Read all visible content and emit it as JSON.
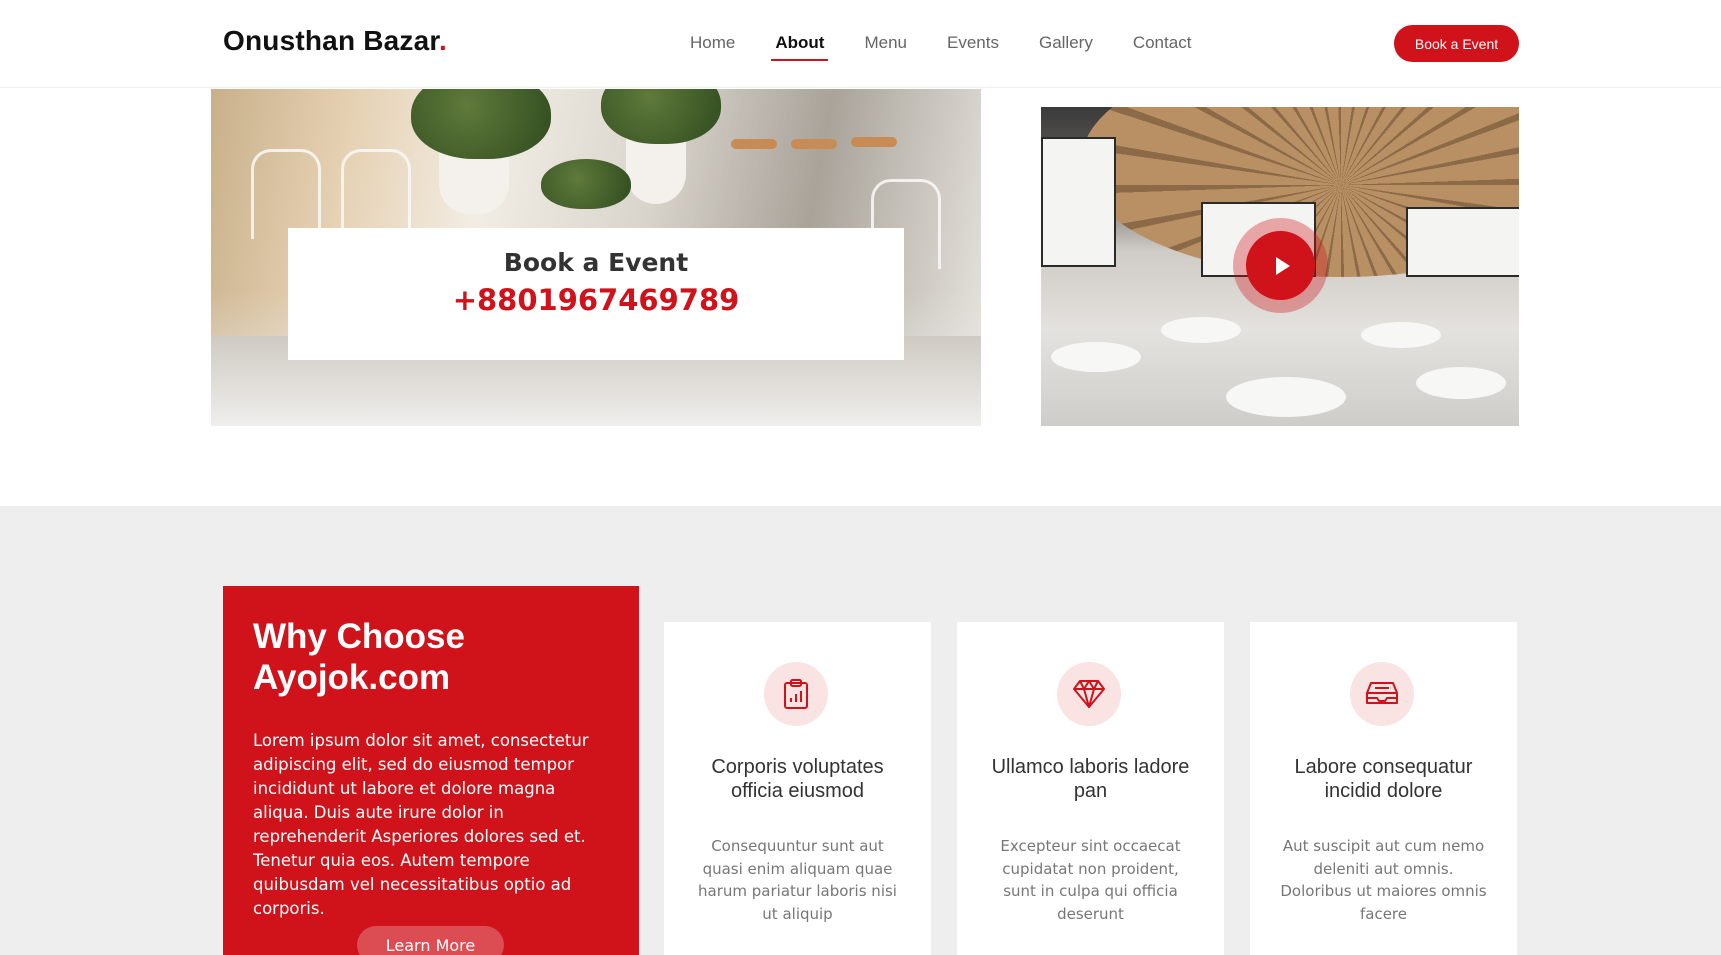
{
  "header": {
    "logo_text": "Onusthan Bazar",
    "logo_dot": ".",
    "nav": [
      {
        "label": "Home"
      },
      {
        "label": "About"
      },
      {
        "label": "Menu"
      },
      {
        "label": "Events"
      },
      {
        "label": "Gallery"
      },
      {
        "label": "Contact"
      }
    ],
    "active_nav": "About",
    "cta_label": "Book a Event"
  },
  "hero": {
    "book_title": "Book a Event",
    "book_phone": "+8801967469789",
    "video_icon": "play-icon"
  },
  "why": {
    "title_line1": "Why Choose",
    "title_line2": "Ayojok.com",
    "text": "Lorem ipsum dolor sit amet, consectetur adipiscing elit, sed do eiusmod tempor incididunt ut labore et dolore magna aliqua. Duis aute irure dolor in reprehenderit Asperiores dolores sed et. Tenetur quia eos. Autem tempore quibusdam vel necessitatibus optio ad corporis.",
    "button_label": "Learn More",
    "cards": [
      {
        "icon": "clipboard-chart-icon",
        "title": "Corporis voluptates officia eiusmod",
        "text": "Consequuntur sunt aut quasi enim aliquam quae harum pariatur laboris nisi ut aliquip"
      },
      {
        "icon": "gem-icon",
        "title": "Ullamco laboris ladore pan",
        "text": "Excepteur sint occaecat cupidatat non proident, sunt in culpa qui officia deserunt"
      },
      {
        "icon": "inbox-icon",
        "title": "Labore consequatur incidid dolore",
        "text": "Aut suscipit aut cum nemo deleniti aut omnis. Doloribus ut maiores omnis facere"
      }
    ]
  },
  "colors": {
    "accent": "#d0121a",
    "section_bg": "#eeeeee",
    "icon_bg": "#f9e3e3"
  }
}
